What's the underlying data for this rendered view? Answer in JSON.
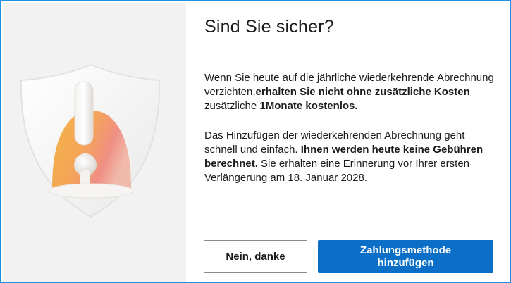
{
  "dialog": {
    "title": "Sind Sie sicher?",
    "para1": {
      "a": "Wenn Sie heute auf die jährliche wiederkehrende Abrechnung verzichten,",
      "b": "erhalten Sie nicht ohne zusätzliche Kosten",
      "c": " zusätzliche ",
      "d": "1Monate kostenlos."
    },
    "para2": {
      "a": "Das Hinzufügen der wiederkehrenden Abrechnung geht schnell und einfach. ",
      "b": "Ihnen werden heute keine Gebühren berechnet.",
      "c": " Sie erhalten eine Erinnerung vor Ihrer ersten Verlängerung am 18. Januar 2028."
    },
    "buttons": {
      "decline": "Nein, danke",
      "add_payment": "Zahlungsmethode hinzufügen"
    },
    "illustration": "shield-bell-icon",
    "colors": {
      "accent": "#0b6fc7",
      "border": "#1f8fe0",
      "pane": "#f2f2f2"
    }
  }
}
